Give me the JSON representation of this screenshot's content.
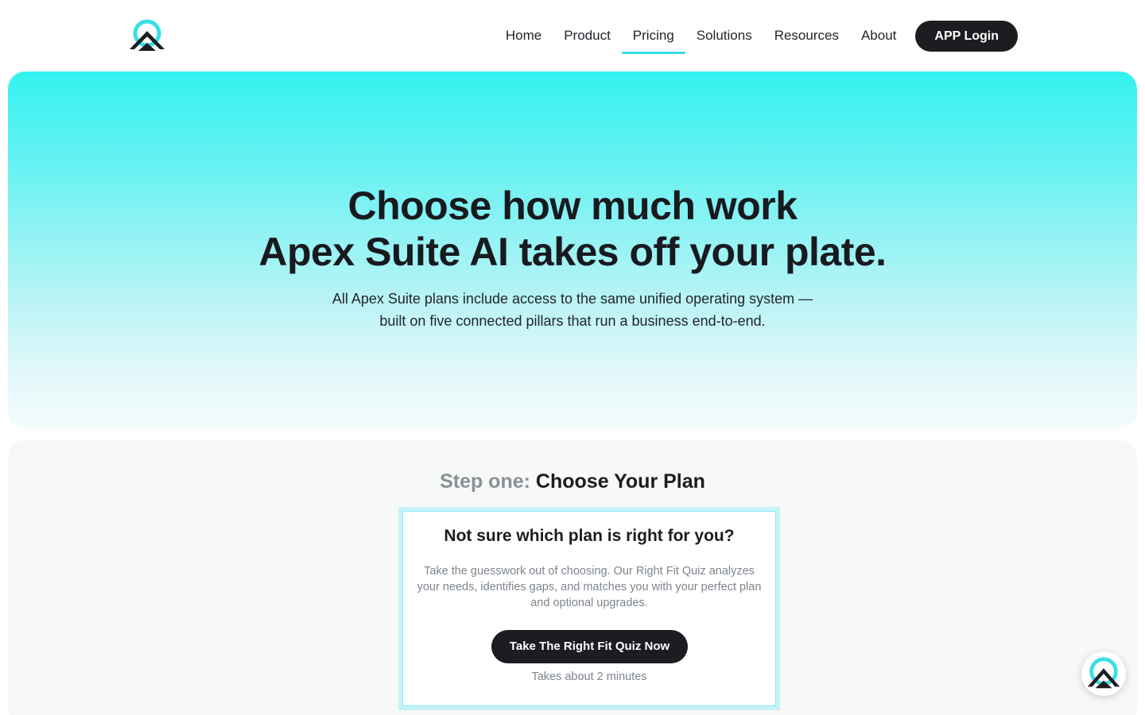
{
  "header": {
    "logo_icon": "apex-logo-icon",
    "nav": [
      {
        "label": "Home"
      },
      {
        "label": "Product"
      },
      {
        "label": "Pricing",
        "active": true
      },
      {
        "label": "Solutions"
      },
      {
        "label": "Resources"
      },
      {
        "label": "About"
      }
    ],
    "login_label": "APP Login"
  },
  "hero": {
    "title_line1": "Choose how much work",
    "title_line2": "Apex Suite AI takes off your plate.",
    "subtitle_line1": "All Apex Suite plans include access to the same unified operating system —",
    "subtitle_line2": "built on five connected pillars that run a business end-to-end."
  },
  "plan": {
    "step_prefix": "Step one:",
    "step_title": "Choose Your Plan",
    "quiz": {
      "title": "Not sure which plan is right for you?",
      "description": "Take the guesswork out of choosing. Our Right Fit Quiz analyzes your needs, identifies gaps, and matches you with your perfect plan and optional upgrades.",
      "button_label": "Take The Right Fit Quiz Now",
      "time_note": "Takes about 2 minutes"
    }
  },
  "chat_widget": {
    "icon": "apex-logo-icon"
  },
  "colors": {
    "accent": "#38dfe8",
    "dark": "#1c1d21",
    "muted": "#7e858c",
    "hero_top": "#33f2f0"
  }
}
